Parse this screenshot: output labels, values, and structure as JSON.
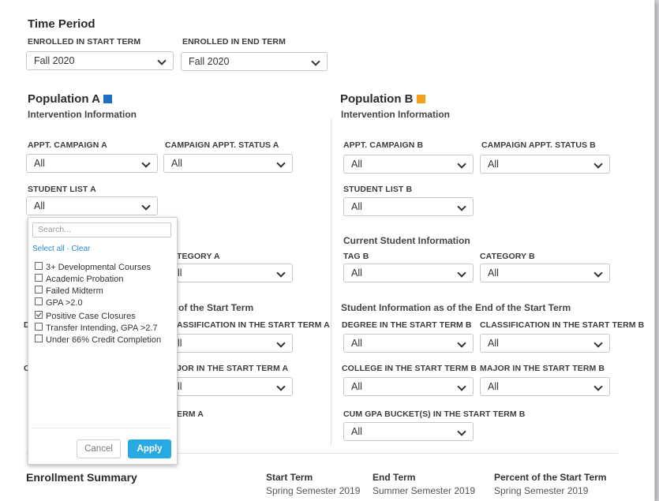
{
  "time_period": {
    "title": "Time Period",
    "start_label": "ENROLLED IN START TERM",
    "start_value": "Fall 2020",
    "end_label": "ENROLLED IN END TERM",
    "end_value": "Fall 2020"
  },
  "population_a": {
    "title": "Population A",
    "color": "#1f6fc6",
    "intervention_title": "Intervention Information",
    "appt_campaign_label": "APPT. CAMPAIGN A",
    "appt_campaign_value": "All",
    "campaign_status_label": "CAMPAIGN APPT. STATUS A",
    "campaign_status_value": "All",
    "student_list_label": "STUDENT LIST A",
    "student_list_value": "All",
    "category_label_partial": "TEGORY A",
    "category_value": "ll",
    "end_of_term_partial": "of the Start Term",
    "classification_label_partial": "ASSIFICATION IN THE START TERM A",
    "classification_value": "ll",
    "major_label_partial": "JOR IN THE START TERM A",
    "major_value": "ll",
    "term_partial": "ERM A",
    "degree_partial": "D",
    "college_partial": "C"
  },
  "dropdown": {
    "search_placeholder": "Search...",
    "links": "Select all · Clear",
    "options": [
      {
        "label": "3+ Developmental Courses",
        "checked": false
      },
      {
        "label": "Academic Probation",
        "checked": false
      },
      {
        "label": "Failed Midterm",
        "checked": false
      },
      {
        "label": "GPA >2.0",
        "checked": false
      },
      {
        "label": "Positive Case Closures",
        "checked": true
      },
      {
        "label": "Transfer Intending, GPA >2.7",
        "checked": false
      },
      {
        "label": "Under 66% Credit Completion",
        "checked": false
      }
    ],
    "cancel_label": "Cancel",
    "apply_label": "Apply",
    "apply_color": "#27aae1"
  },
  "population_b": {
    "title": "Population B",
    "color": "#f5a01a",
    "intervention_title": "Intervention Information",
    "appt_campaign_label": "APPT. CAMPAIGN B",
    "appt_campaign_value": "All",
    "campaign_status_label": "CAMPAIGN APPT. STATUS B",
    "campaign_status_value": "All",
    "student_list_label": "STUDENT LIST B",
    "student_list_value": "All",
    "current_info_title": "Current Student Information",
    "tag_label": "TAG B",
    "tag_value": "All",
    "category_label": "CATEGORY B",
    "category_value": "All",
    "end_of_term_title": "Student Information as of the End of the Start Term",
    "degree_label": "DEGREE IN THE START TERM B",
    "degree_value": "All",
    "classification_label": "CLASSIFICATION IN THE START TERM B",
    "classification_value": "All",
    "college_label": "COLLEGE IN THE START TERM B",
    "college_value": "All",
    "major_label": "MAJOR IN THE START TERM B",
    "major_value": "All",
    "gpa_bucket_label": "CUM GPA BUCKET(S) IN THE START TERM B",
    "gpa_bucket_value": "All"
  },
  "summary": {
    "title": "Enrollment Summary",
    "start_term_header": "Start Term",
    "start_term_value": "Spring Semester 2019",
    "end_term_header": "End Term",
    "end_term_value": "Summer Semester 2019",
    "percent_header": "Percent of the Start Term",
    "percent_value": "Spring Semester 2019"
  }
}
